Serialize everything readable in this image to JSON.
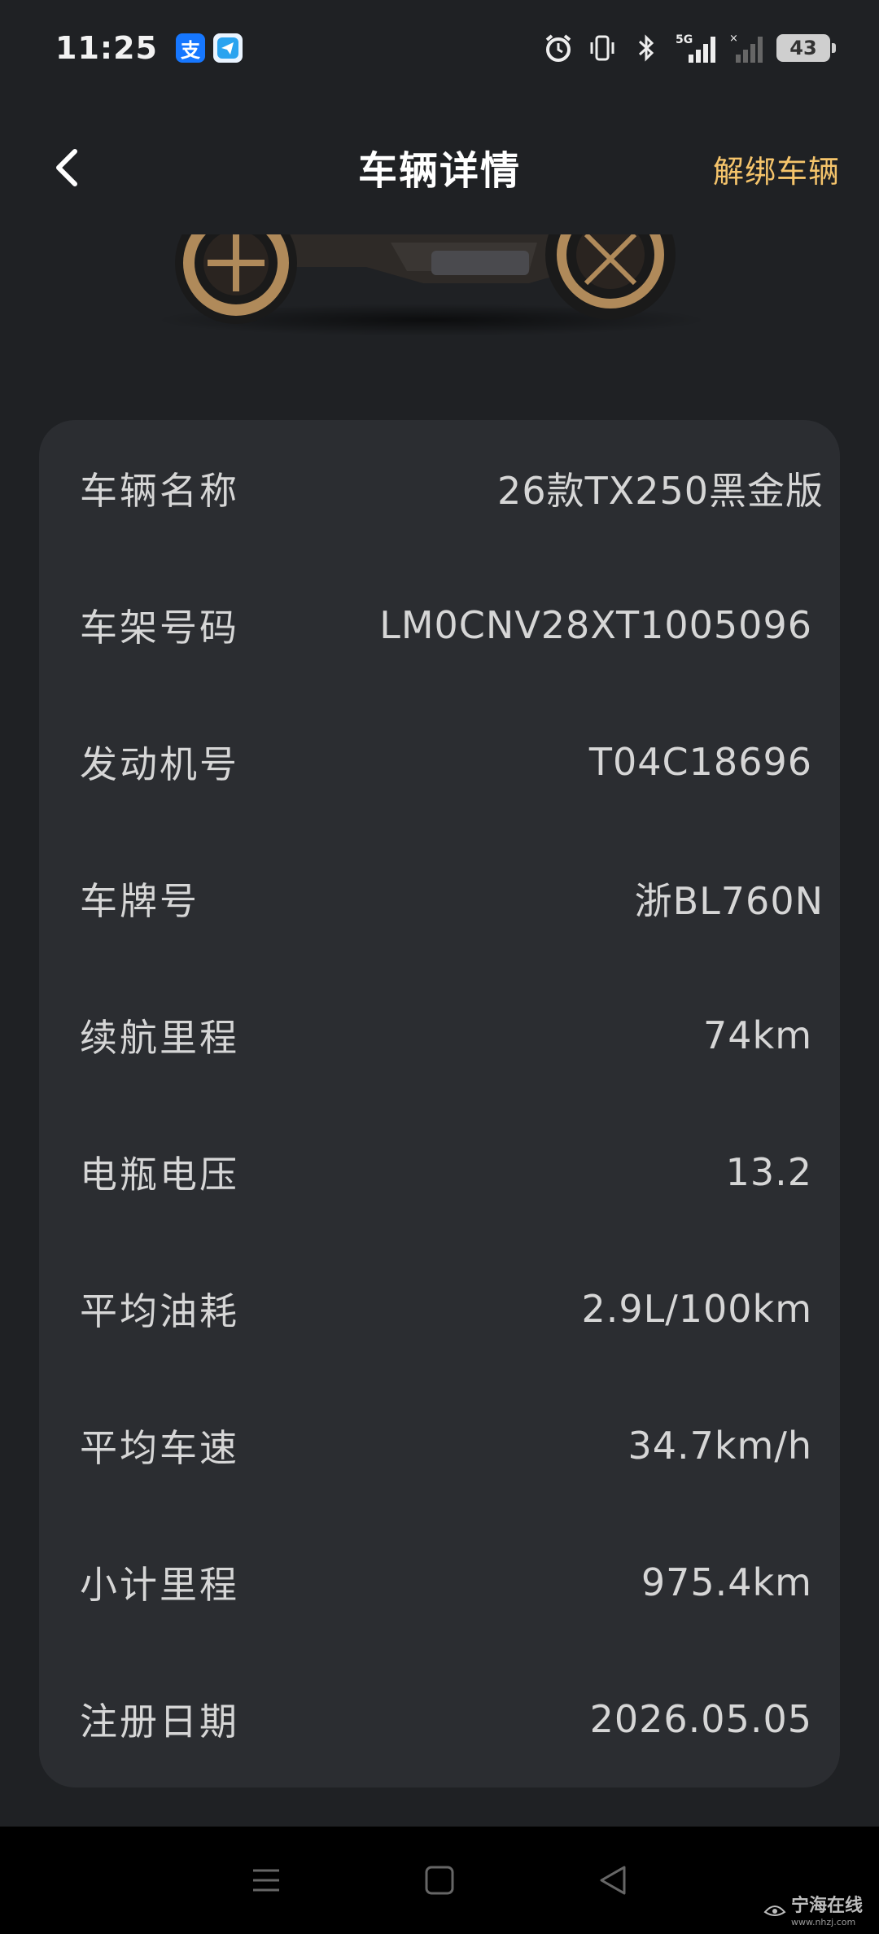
{
  "status_bar": {
    "time": "11:25",
    "app_icons": [
      "alipay-icon",
      "telegram-icon"
    ],
    "app_badges": {
      "alipay": "支"
    },
    "indicators": [
      "alarm-icon",
      "vibrate-icon",
      "bluetooth-icon",
      "signal-5g-icon",
      "signal-icon"
    ],
    "network_label": "5G",
    "battery": "43"
  },
  "header": {
    "title": "车辆详情",
    "action_label": "解绑车辆",
    "action_color": "#f5c46b",
    "back_icon": "chevron-left-icon"
  },
  "details": [
    {
      "label": "车辆名称",
      "value": "26款TX250黑金版"
    },
    {
      "label": "车架号码",
      "value": "LM0CNV28XT1005096"
    },
    {
      "label": "发动机号",
      "value": "T04C18696"
    },
    {
      "label": "车牌号",
      "value": "浙BL760N"
    },
    {
      "label": "续航里程",
      "value": "74km"
    },
    {
      "label": "电瓶电压",
      "value": "13.2"
    },
    {
      "label": "平均油耗",
      "value": "2.9L/100km"
    },
    {
      "label": "平均车速",
      "value": "34.7km/h"
    },
    {
      "label": "小计里程",
      "value": "975.4km"
    },
    {
      "label": "注册日期",
      "value": "2026.05.05"
    }
  ],
  "nav_bar": {
    "buttons": [
      "menu-icon",
      "home-icon",
      "back-triangle-icon"
    ]
  },
  "watermark": {
    "text": "宁海在线",
    "url_text": "www.nhzj.com"
  },
  "colors": {
    "background": "#1f2124",
    "card": "#2b2d31",
    "accent": "#f5c46b"
  }
}
